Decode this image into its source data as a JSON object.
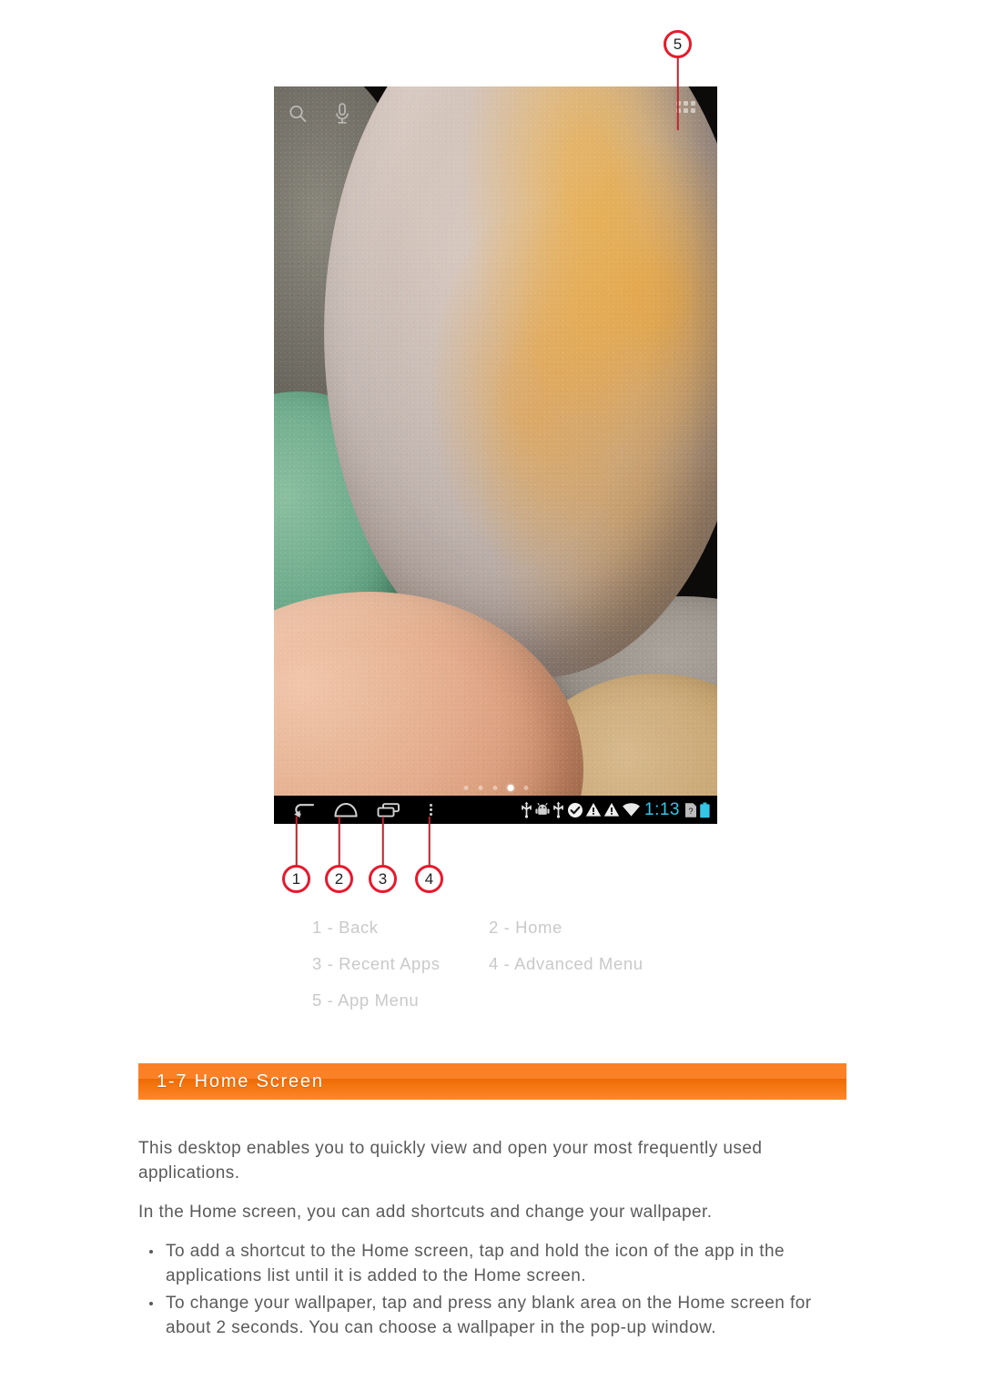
{
  "figure": {
    "device_screenshot": {
      "wallpaper_description": "close-up photo of smooth river pebbles",
      "top_icons": [
        {
          "name": "search-icon",
          "glyph": "magnifier"
        },
        {
          "name": "microphone-icon",
          "glyph": "mic"
        },
        {
          "name": "app-grid-icon",
          "glyph": "grid-of-dots"
        }
      ],
      "page_indicator": {
        "total": 5,
        "active_index": 3
      },
      "navbar": {
        "buttons": [
          {
            "name": "back-button",
            "label": "Back"
          },
          {
            "name": "home-button",
            "label": "Home"
          },
          {
            "name": "recent-apps-button",
            "label": "Recent Apps"
          },
          {
            "name": "advanced-menu-button",
            "label": "Advanced Menu"
          }
        ],
        "status_icons": [
          "usb-icon",
          "android-debug-icon",
          "usb-icon",
          "check-circle-icon",
          "warning-triangle-icon",
          "warning-triangle-icon",
          "wifi-icon"
        ],
        "clock": "1:13",
        "trailing_icons": [
          "sim-card-unknown-icon",
          "battery-icon"
        ],
        "clock_color": "#35c6e8",
        "battery_color": "#35c6e8"
      }
    },
    "callouts": [
      {
        "number": "5",
        "target": "app-grid-icon"
      },
      {
        "number": "1",
        "target": "back-button"
      },
      {
        "number": "2",
        "target": "home-button"
      },
      {
        "number": "3",
        "target": "recent-apps-button"
      },
      {
        "number": "4",
        "target": "advanced-menu-button"
      }
    ],
    "callout_color": "#e8192c",
    "legend": [
      [
        "1 - Back",
        "2 - Home"
      ],
      [
        "3 - Recent Apps",
        "4 - Advanced Menu"
      ],
      [
        "5 - App Menu",
        ""
      ]
    ]
  },
  "section": {
    "heading": "1-7 Home Screen",
    "accent_color": "#fb8127"
  },
  "content": {
    "paragraphs": [
      "This desktop enables you to quickly view and open your most frequently used applications.",
      "In the Home screen, you can add shortcuts and change your wallpaper."
    ],
    "bullets": [
      "To add a shortcut to the Home screen, tap and hold the icon of the app in the applications list until it is added to the Home screen.",
      "To change your wallpaper, tap and press any blank area on the Home screen for about 2 seconds. You can choose a wallpaper in the pop-up window."
    ]
  }
}
